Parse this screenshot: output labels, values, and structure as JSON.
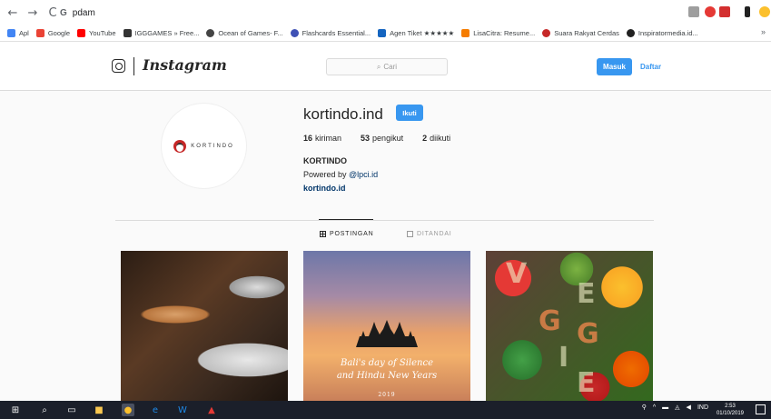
{
  "browser": {
    "nav": {
      "back": "←",
      "forward": "→",
      "reload": "C"
    },
    "omnibox_prefix": "G",
    "address": "pdam",
    "bookmarks": [
      {
        "label": "Apl",
        "color": "#4285f4"
      },
      {
        "label": "Google",
        "color": "#ea4335"
      },
      {
        "label": "YouTube",
        "color": "#ff0000"
      },
      {
        "label": "IGGGAMES » Free...",
        "color": "#333333"
      },
      {
        "label": "Ocean of Games- F...",
        "color": "#444444"
      },
      {
        "label": "Flashcards Essential...",
        "color": "#3f51b5"
      },
      {
        "label": "Agen Tiket ★★★★★",
        "color": "#1565c0"
      },
      {
        "label": "LisaCitra: Resume...",
        "color": "#f57c00"
      },
      {
        "label": "Suara Rakyat Cerdas",
        "color": "#c62828"
      },
      {
        "label": "Inspiratormedia.id...",
        "color": "#212121"
      }
    ],
    "bookmarks_more": "»"
  },
  "instagram": {
    "wordmark": "Instagram",
    "search_placeholder": "Cari",
    "login_label": "Masuk",
    "signup_label": "Daftar"
  },
  "profile": {
    "avatar_text": "KORTINDO",
    "username": "kortindo.ind",
    "follow_label": "Ikuti",
    "stats": [
      {
        "value": "16",
        "label": "kiriman"
      },
      {
        "value": "53",
        "label": "pengikut"
      },
      {
        "value": "2",
        "label": "diikuti"
      }
    ],
    "full_name": "KORTINDO",
    "bio_prefix": "Powered by ",
    "bio_mention": "@lpci.id",
    "website": "kortindo.id"
  },
  "tabs": {
    "posts": "POSTINGAN",
    "tagged": "DITANDAI"
  },
  "posts": {
    "post2_line1": "Bali's day of Silence",
    "post2_line2": "and Hindu New Years",
    "post2_year": "2019",
    "post3_letters": [
      "V",
      "E",
      "G",
      "G",
      "I",
      "E"
    ]
  },
  "taskbar": {
    "language": "IND",
    "time": "2:53",
    "date": "01/10/2019"
  }
}
